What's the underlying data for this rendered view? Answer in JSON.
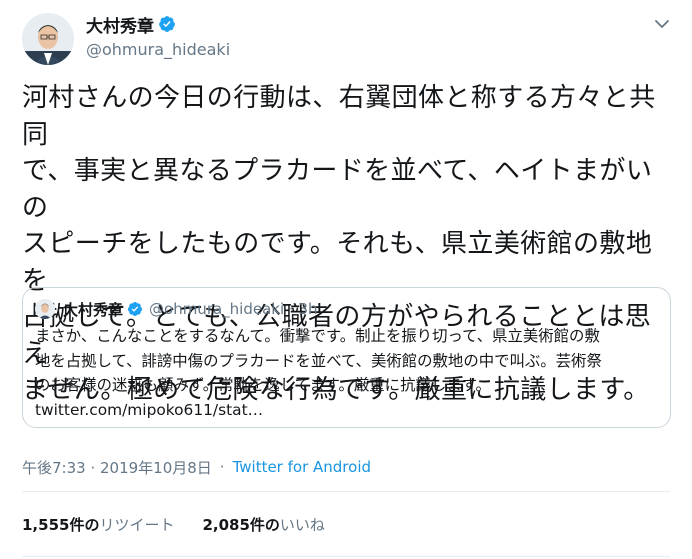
{
  "author": {
    "name": "大村秀章",
    "handle": "@ohmura_hideaki"
  },
  "tweet": {
    "text_lines": [
      "河村さんの今日の行動は、右翼団体と称する方々と共同",
      "で、事実と異なるプラカードを並べて、ヘイトまがいの",
      "スピーチをしたものです。それも、県立美術館の敷地を",
      "占拠して。とても、公職者の方がやられることとは思え",
      "ません。極めて危険な行為です。厳重に抗議します。"
    ],
    "timestamp": "午後7:33 · 2019年10月8日",
    "separator": "·",
    "source": "Twitter for Android"
  },
  "quoted": {
    "name": "大村秀章",
    "handle": "@ohmura_hideaki · 3h",
    "text_lines": [
      "まさか、こんなことをするなんて。衝撃です。制止を振り切って、県立美術館の敷",
      "地を占拠して、誹謗中傷のプラカードを並べて、美術館の敷地の中で叫ぶ。芸術祭",
      "のお客様の迷惑も顧みず。常軌を逸してます。厳重に抗議します。",
      "twitter.com/mipoko611/stat…"
    ]
  },
  "stats": {
    "retweets_count": "1,555件の",
    "retweets_label": "リツイート",
    "likes_count": "2,085件の",
    "likes_label": "いいね"
  },
  "colors": {
    "verified": "#1da1f2",
    "link": "#1b95e0",
    "secondary_text": "#657786",
    "border": "#ccd6dd"
  },
  "icons": {
    "verified": "verified-badge-icon",
    "menu": "chevron-down-icon"
  }
}
